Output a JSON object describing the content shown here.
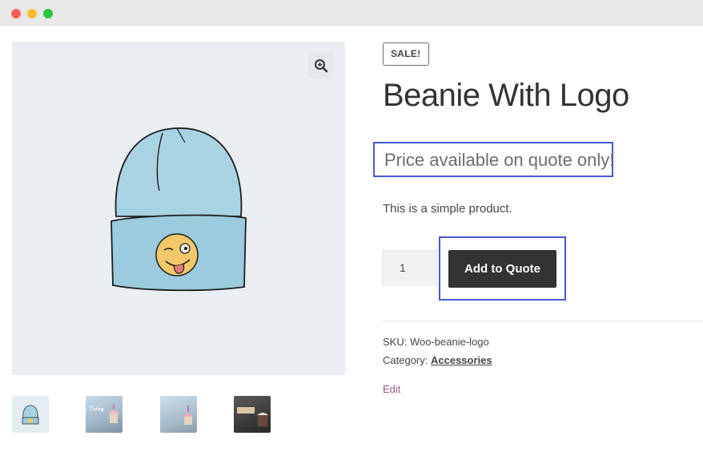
{
  "window": {
    "controls": [
      "close",
      "minimize",
      "maximize"
    ]
  },
  "gallery": {
    "zoom_icon": "magnifier-plus-icon",
    "thumbnails": [
      {
        "name": "beanie-thumbnail"
      },
      {
        "name": "birthday-cupcake-thumbnail-1"
      },
      {
        "name": "birthday-cupcake-thumbnail-2"
      },
      {
        "name": "birthday-cake-thumbnail-dark"
      }
    ]
  },
  "product": {
    "badge": "SALE!",
    "title": "Beanie With Logo",
    "price_text": "Price available on quote only!",
    "description": "This is a simple product.",
    "quantity": "1",
    "add_button_label": "Add to Quote",
    "sku_label": "SKU: ",
    "sku_value": "Woo-beanie-logo",
    "category_label": "Category: ",
    "category_value": "Accessories",
    "edit_label": "Edit"
  },
  "colors": {
    "highlight_border": "#4659d6",
    "button_bg": "#333333",
    "edit_link": "#96588a"
  }
}
